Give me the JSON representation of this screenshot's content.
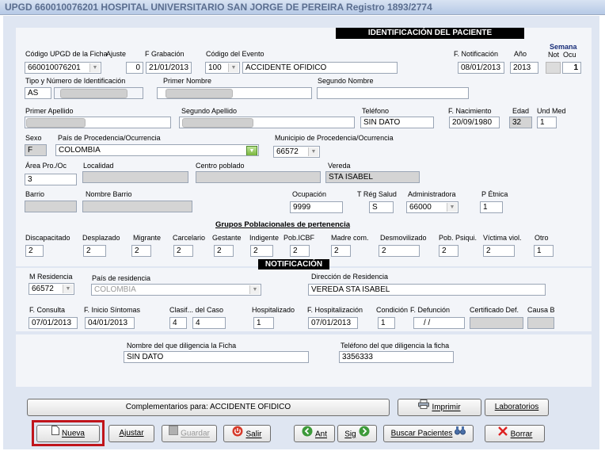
{
  "window": {
    "title": "UPGD 660010076201 HOSPITAL UNIVERSITARIO SAN JORGE DE PEREIRA Registro 1893/2774"
  },
  "sections": {
    "identificacion": "IDENTIFICACIÓN DEL PACIENTE",
    "grupos": "Grupos Poblacionales de pertenencia",
    "notificacion": "NOTIFICACIÓN"
  },
  "row1": {
    "codigo_upgd_label": "Código UPGD de la Ficha",
    "codigo_upgd": "660010076201",
    "ajuste_label": "Ajuste",
    "ajuste": "0",
    "f_grabacion_label": "F Grabación",
    "f_grabacion": "21/01/2013",
    "codigo_evento_label": "Código del Evento",
    "codigo_evento": "100",
    "evento_nombre": "ACCIDENTE OFIDICO",
    "f_notificacion_label": "F. Notificación",
    "f_notificacion": "08/01/2013",
    "anio_label": "Año",
    "anio": "2013",
    "semana_label": "Semana",
    "not_label": "Not",
    "ocu_label": "Ocu",
    "semana_not": "",
    "semana_ocu": "1"
  },
  "row2": {
    "tipo_label": "Tipo y Número de Identificación",
    "tipo": "AS",
    "primer_nombre_label": "Primer Nombre",
    "segundo_nombre_label": "Segundo Nombre",
    "segundo_nombre": ""
  },
  "row3": {
    "primer_apellido_label": "Primer Apellido",
    "segundo_apellido_label": "Segundo Apellido",
    "telefono_label": "Teléfono",
    "telefono": "SIN DATO",
    "f_nacimiento_label": "F. Nacimiento",
    "f_nacimiento": "20/09/1980",
    "edad_label": "Edad",
    "edad": "32",
    "und_med_label": "Und Med",
    "und_med": "1"
  },
  "row4": {
    "sexo_label": "Sexo",
    "sexo": "F",
    "pais_label": "País de Procedencia/Ocurrencia",
    "pais": "COLOMBIA",
    "municipio_label": "Municipio de Procedencia/Ocurrencia",
    "municipio": "66572"
  },
  "row5": {
    "area_label": "Área Pro./Oc",
    "area": "3",
    "localidad_label": "Localidad",
    "centro_poblado_label": "Centro poblado",
    "vereda_label": "Vereda",
    "vereda": "STA ISABEL"
  },
  "row6": {
    "barrio_label": "Barrio",
    "nombre_barrio_label": "Nombre Barrio",
    "ocupacion_label": "Ocupación",
    "ocupacion": "9999",
    "t_reg_label": "T Rég Salud",
    "t_reg": "S",
    "administradora_label": "Administradora",
    "administradora": "66000",
    "p_etnica_label": "P Étnica",
    "p_etnica": "1"
  },
  "grupos": [
    {
      "label": "Discapacitado",
      "value": "2"
    },
    {
      "label": "Desplazado",
      "value": "2"
    },
    {
      "label": "Migrante",
      "value": "2"
    },
    {
      "label": "Carcelario",
      "value": "2"
    },
    {
      "label": "Gestante",
      "value": "2"
    },
    {
      "label": "Indigente",
      "value": "2"
    },
    {
      "label": "Pob.ICBF",
      "value": "2"
    },
    {
      "label": "Madre com.",
      "value": "2"
    },
    {
      "label": "Desmovilizado",
      "value": "2"
    },
    {
      "label": "Pob. Psiqui.",
      "value": "2"
    },
    {
      "label": "Víctima viol.",
      "value": "2"
    },
    {
      "label": "Otro",
      "value": "1"
    }
  ],
  "notif1": {
    "m_residencia_label": "M Residencia",
    "m_residencia": "66572",
    "pais_res_label": "País de residencia",
    "pais_res": "COLOMBIA",
    "direccion_label": "Dirección de Residencia",
    "direccion": "VEREDA STA ISABEL"
  },
  "notif2": {
    "f_consulta_label": "F. Consulta",
    "f_consulta": "07/01/2013",
    "f_inicio_label": "F. Inicio Síntomas",
    "f_inicio": "04/01/2013",
    "clasif_label": "Clasif... del Caso",
    "clasif_a": "4",
    "clasif_b": "4",
    "hospitalizado_label": "Hospitalizado",
    "hospitalizado": "1",
    "f_hosp_label": "F. Hospitalización",
    "f_hosp": "07/01/2013",
    "condicion_label": "Condición",
    "condicion": "1",
    "f_defuncion_label": "F. Defunción",
    "f_defuncion": "/ /",
    "certificado_label": "Certificado Def.",
    "causa_label": "Causa B"
  },
  "diligencia": {
    "nombre_label": "Nombre del que diligencia la Ficha",
    "nombre": "SIN DATO",
    "telefono_label": "Teléfono del que diligencia la ficha",
    "telefono": "3356333"
  },
  "buttons": {
    "complementarios": "Complementarios para: ACCIDENTE OFIDICO",
    "imprimir": "Imprimir",
    "laboratorios": "Laboratorios",
    "nueva": "Nueva",
    "ajustar": "Ajustar",
    "guardar": "Guardar",
    "salir": "Salir",
    "ant": "Ant",
    "sig": "Sig",
    "buscar": "Buscar Pacientes",
    "borrar": "Borrar"
  },
  "colors": {
    "highlight": "#c0151c",
    "header_bg": "#000000",
    "panel": "#f3f5f9",
    "frame": "#dfe6f2"
  }
}
